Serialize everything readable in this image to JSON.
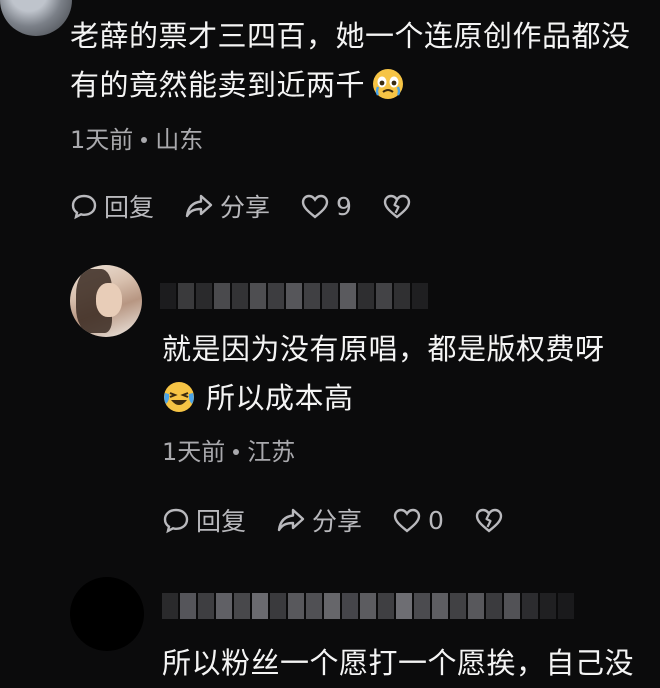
{
  "comments": [
    {
      "text_lines": [
        "老薛的票才三四百，她一个连原创作品都没",
        "有的竟然能卖到近两千"
      ],
      "emoji": "crying-face",
      "time": "1天前",
      "location": "山东",
      "reply_label": "回复",
      "share_label": "分享",
      "like_count": "9"
    },
    {
      "text_lines": [
        "就是因为没有原唱，都是版权费呀",
        "所以成本高"
      ],
      "emoji": "laughing-crying-face",
      "time": "1天前",
      "location": "江苏",
      "reply_label": "回复",
      "share_label": "分享",
      "like_count": "0"
    },
    {
      "text_lines": [
        "所以粉丝一个愿打一个愿挨，自己没"
      ]
    }
  ],
  "colors": {
    "background": "#0b0b0c",
    "text": "#f4f4f4",
    "meta": "#a9a9ad",
    "icon": "#b9b9bd"
  }
}
